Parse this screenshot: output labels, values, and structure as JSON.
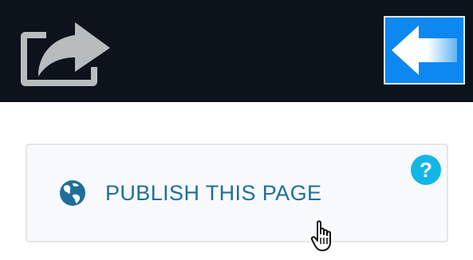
{
  "header": {
    "share_icon": "share-icon",
    "back_icon": "arrow-left-icon",
    "colors": {
      "bar": "#0c131b",
      "back_button": "#0c88f0"
    }
  },
  "card": {
    "help_icon": "question-circle-icon",
    "help_glyph": "?",
    "globe_icon": "globe-icon",
    "publish_label": "PUBLISH THIS PAGE",
    "colors": {
      "label": "#1f6f9a",
      "help": "#12b6e6",
      "border": "#e4e6ea"
    }
  },
  "cursor_icon": "hand-pointer-icon"
}
